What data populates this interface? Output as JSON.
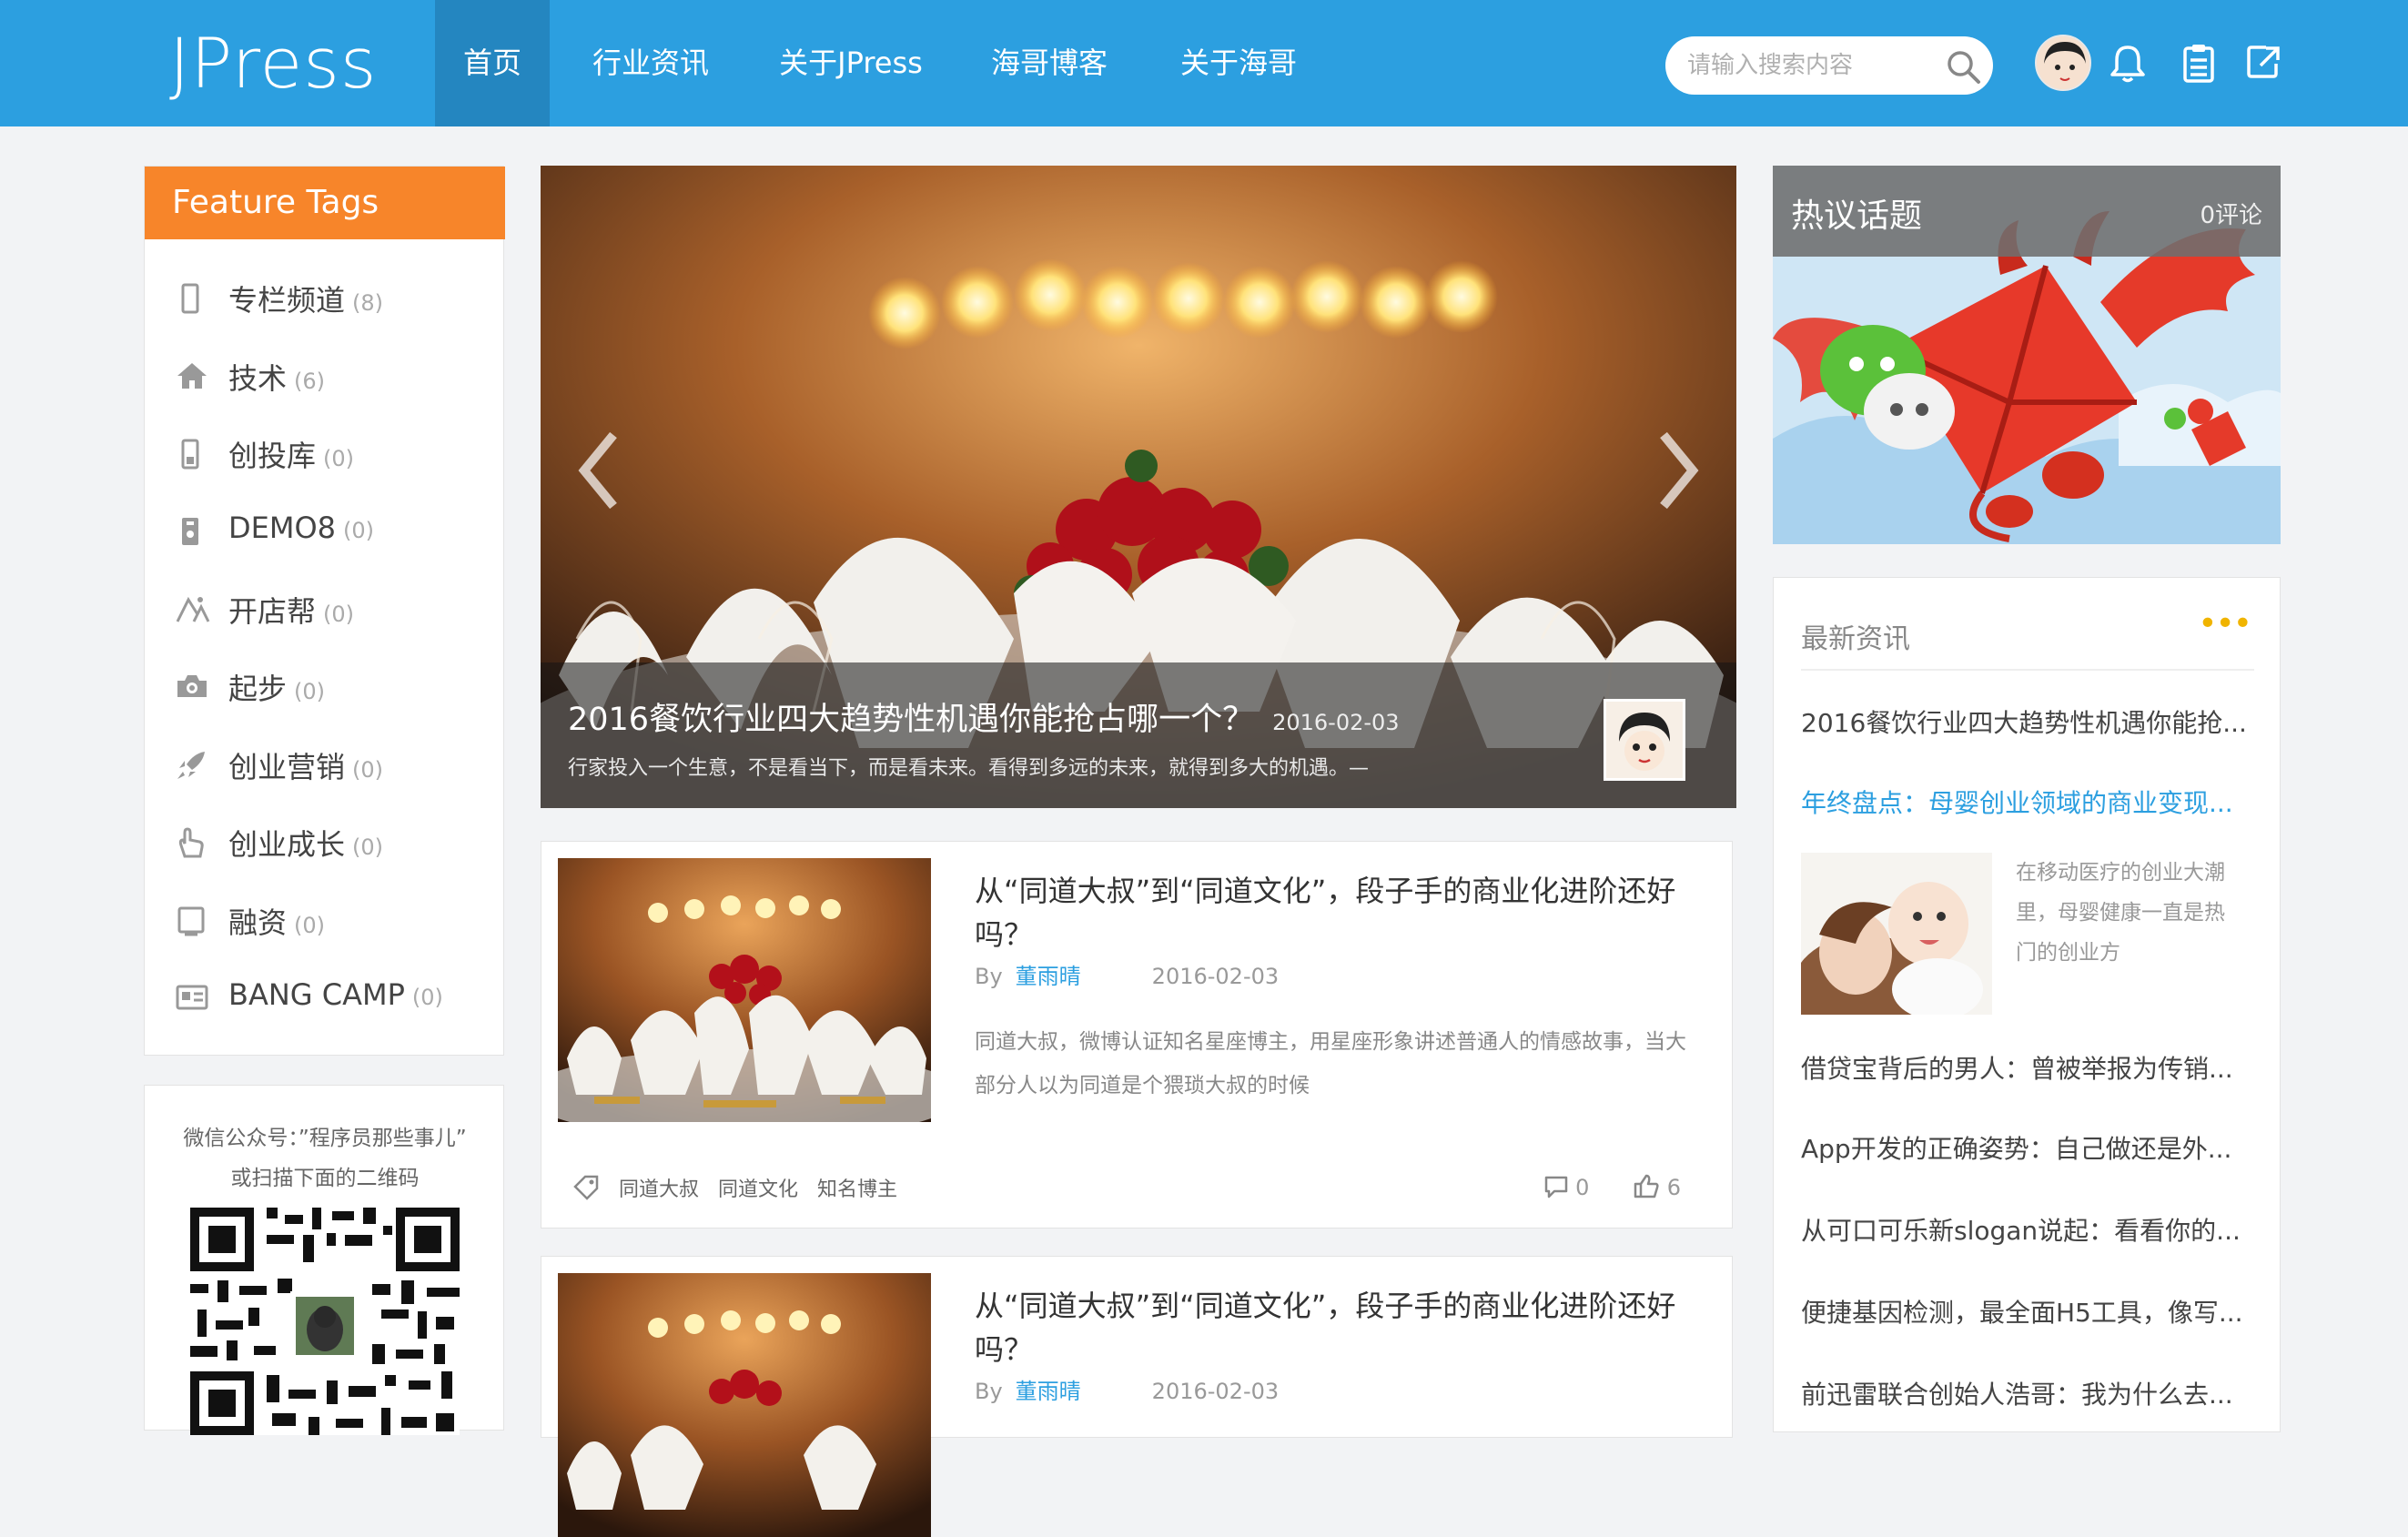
{
  "header": {
    "logo": "JPress",
    "nav": [
      {
        "label": "首页",
        "active": true
      },
      {
        "label": "行业资讯",
        "active": false
      },
      {
        "label": "关于JPress",
        "active": false
      },
      {
        "label": "海哥博客",
        "active": false
      },
      {
        "label": "关于海哥",
        "active": false
      }
    ],
    "search_placeholder": "请输入搜索内容",
    "icons": [
      "search-icon",
      "bell-icon",
      "clipboard-icon",
      "logout-icon"
    ],
    "accent_color": "#2c9fe0"
  },
  "feature_tags": {
    "title": "Feature Tags",
    "title_color": "#f7852a",
    "items": [
      {
        "name": "专栏频道",
        "count": "(8)",
        "icon": "mobile-icon"
      },
      {
        "name": "技术",
        "count": "(6)",
        "icon": "home-icon"
      },
      {
        "name": "创投库",
        "count": "(0)",
        "icon": "phone-icon"
      },
      {
        "name": "DEMO8",
        "count": "(0)",
        "icon": "phone-icon"
      },
      {
        "name": "开店帮",
        "count": "(0)",
        "icon": "shapes-icon"
      },
      {
        "name": "起步",
        "count": "(0)",
        "icon": "camera-icon"
      },
      {
        "name": "创业营销",
        "count": "(0)",
        "icon": "rocket-icon"
      },
      {
        "name": "创业成长",
        "count": "(0)",
        "icon": "hand-icon"
      },
      {
        "name": "融资",
        "count": "(0)",
        "icon": "square-icon"
      },
      {
        "name": "BANG CAMP",
        "count": "(0)",
        "icon": "id-card-icon"
      }
    ]
  },
  "wechat": {
    "line1": "微信公众号：”程序员那些事儿”",
    "line2": "或扫描下面的二维码"
  },
  "carousel": {
    "title": "2016餐饮行业四大趋势性机遇你能抢占哪一个？",
    "date": "2016-02-03",
    "summary": "行家投入一个生意，不是看当下，而是看未来。看得到多远的未来，就得到多大的机遇。—"
  },
  "articles": [
    {
      "title": "从“同道大叔”到“同道文化”，段子手的商业化进阶还好吗？",
      "by": "By",
      "author": "董雨晴",
      "date": "2016-02-03",
      "excerpt": "同道大叔，微博认证知名星座博主，用星座形象讲述普通人的情感故事，当大部分人以为同道是个猥琐大叔的时候",
      "tags": [
        "同道大叔",
        "同道文化",
        "知名博主"
      ],
      "comments": "0",
      "likes": "6"
    },
    {
      "title": "从“同道大叔”到“同道文化”，段子手的商业化进阶还好吗？",
      "by": "By",
      "author": "董雨晴",
      "date": "2016-02-03"
    }
  ],
  "hot_topic": {
    "title": "热议话题",
    "count": "0评论"
  },
  "latest_news": {
    "heading": "最新资讯",
    "more": "•••",
    "items": [
      "2016餐饮行业四大趋势性机遇你能抢...",
      "年终盘点：母婴创业领域的商业变现...",
      "借贷宝背后的男人：曾被举报为传销...",
      "App开发的正确姿势：自己做还是外...",
      "从可口可乐新slogan说起：看看你的...",
      "便捷基因检测，最全面H5工具，像写...",
      "前迅雷联合创始人浩哥：我为什么去..."
    ],
    "feature_text": "在移动医疗的创业大潮里，母婴健康一直是热门的创业方"
  }
}
